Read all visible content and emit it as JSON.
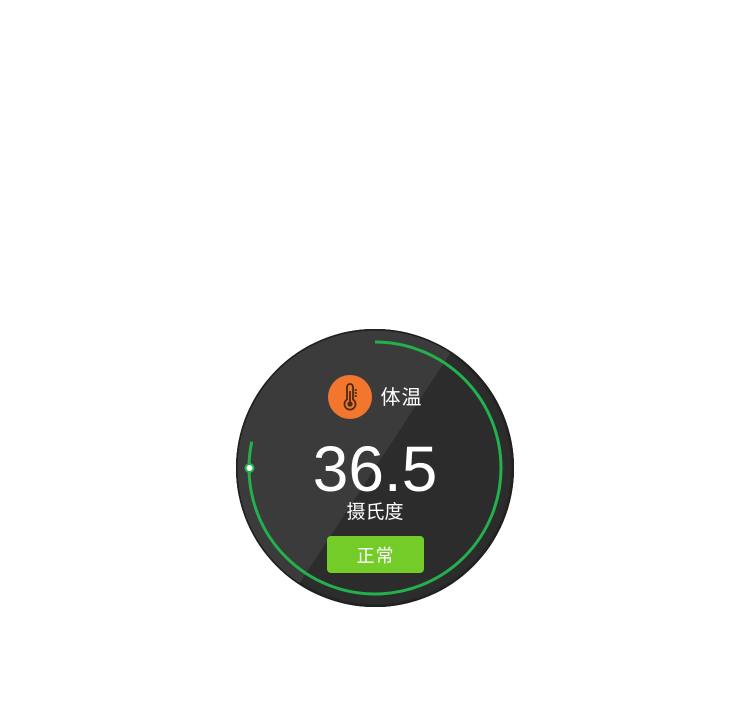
{
  "widget": {
    "metric_label": "体温",
    "metric_icon": "thermometer-icon",
    "value": "36.5",
    "unit": "摄氏度",
    "status": "正常"
  },
  "colors": {
    "face": "#2a2a2a",
    "face_highlight": "#3b3b3b",
    "icon_badge": "#f2762e",
    "ring": "#22b14c",
    "status_badge": "#74cc28"
  }
}
